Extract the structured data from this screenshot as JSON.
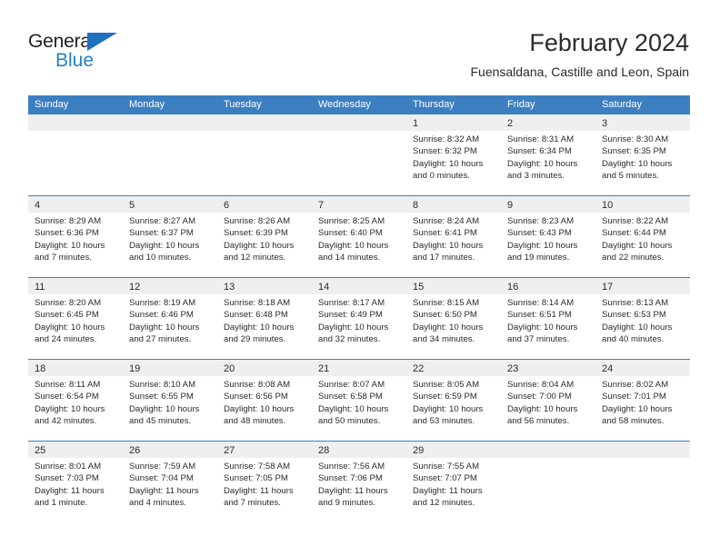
{
  "brand": {
    "name_top": "General",
    "name_bottom": "Blue",
    "triangle_color": "#1f72bd",
    "text_color": "#231f20",
    "blue_color": "#2581c4"
  },
  "header": {
    "title": "February 2024",
    "subtitle": "Fuensaldana, Castille and Leon, Spain"
  },
  "calendar": {
    "header_bg": "#3c7fc1",
    "header_text_color": "#ffffff",
    "band_bg": "#efefef",
    "weekdays": [
      "Sunday",
      "Monday",
      "Tuesday",
      "Wednesday",
      "Thursday",
      "Friday",
      "Saturday"
    ],
    "weeks": [
      [
        {
          "day": "",
          "lines": []
        },
        {
          "day": "",
          "lines": []
        },
        {
          "day": "",
          "lines": []
        },
        {
          "day": "",
          "lines": []
        },
        {
          "day": "1",
          "lines": [
            "Sunrise: 8:32 AM",
            "Sunset: 6:32 PM",
            "Daylight: 10 hours",
            "and 0 minutes."
          ]
        },
        {
          "day": "2",
          "lines": [
            "Sunrise: 8:31 AM",
            "Sunset: 6:34 PM",
            "Daylight: 10 hours",
            "and 3 minutes."
          ]
        },
        {
          "day": "3",
          "lines": [
            "Sunrise: 8:30 AM",
            "Sunset: 6:35 PM",
            "Daylight: 10 hours",
            "and 5 minutes."
          ]
        }
      ],
      [
        {
          "day": "4",
          "lines": [
            "Sunrise: 8:29 AM",
            "Sunset: 6:36 PM",
            "Daylight: 10 hours",
            "and 7 minutes."
          ]
        },
        {
          "day": "5",
          "lines": [
            "Sunrise: 8:27 AM",
            "Sunset: 6:37 PM",
            "Daylight: 10 hours",
            "and 10 minutes."
          ]
        },
        {
          "day": "6",
          "lines": [
            "Sunrise: 8:26 AM",
            "Sunset: 6:39 PM",
            "Daylight: 10 hours",
            "and 12 minutes."
          ]
        },
        {
          "day": "7",
          "lines": [
            "Sunrise: 8:25 AM",
            "Sunset: 6:40 PM",
            "Daylight: 10 hours",
            "and 14 minutes."
          ]
        },
        {
          "day": "8",
          "lines": [
            "Sunrise: 8:24 AM",
            "Sunset: 6:41 PM",
            "Daylight: 10 hours",
            "and 17 minutes."
          ]
        },
        {
          "day": "9",
          "lines": [
            "Sunrise: 8:23 AM",
            "Sunset: 6:43 PM",
            "Daylight: 10 hours",
            "and 19 minutes."
          ]
        },
        {
          "day": "10",
          "lines": [
            "Sunrise: 8:22 AM",
            "Sunset: 6:44 PM",
            "Daylight: 10 hours",
            "and 22 minutes."
          ]
        }
      ],
      [
        {
          "day": "11",
          "lines": [
            "Sunrise: 8:20 AM",
            "Sunset: 6:45 PM",
            "Daylight: 10 hours",
            "and 24 minutes."
          ]
        },
        {
          "day": "12",
          "lines": [
            "Sunrise: 8:19 AM",
            "Sunset: 6:46 PM",
            "Daylight: 10 hours",
            "and 27 minutes."
          ]
        },
        {
          "day": "13",
          "lines": [
            "Sunrise: 8:18 AM",
            "Sunset: 6:48 PM",
            "Daylight: 10 hours",
            "and 29 minutes."
          ]
        },
        {
          "day": "14",
          "lines": [
            "Sunrise: 8:17 AM",
            "Sunset: 6:49 PM",
            "Daylight: 10 hours",
            "and 32 minutes."
          ]
        },
        {
          "day": "15",
          "lines": [
            "Sunrise: 8:15 AM",
            "Sunset: 6:50 PM",
            "Daylight: 10 hours",
            "and 34 minutes."
          ]
        },
        {
          "day": "16",
          "lines": [
            "Sunrise: 8:14 AM",
            "Sunset: 6:51 PM",
            "Daylight: 10 hours",
            "and 37 minutes."
          ]
        },
        {
          "day": "17",
          "lines": [
            "Sunrise: 8:13 AM",
            "Sunset: 6:53 PM",
            "Daylight: 10 hours",
            "and 40 minutes."
          ]
        }
      ],
      [
        {
          "day": "18",
          "lines": [
            "Sunrise: 8:11 AM",
            "Sunset: 6:54 PM",
            "Daylight: 10 hours",
            "and 42 minutes."
          ]
        },
        {
          "day": "19",
          "lines": [
            "Sunrise: 8:10 AM",
            "Sunset: 6:55 PM",
            "Daylight: 10 hours",
            "and 45 minutes."
          ]
        },
        {
          "day": "20",
          "lines": [
            "Sunrise: 8:08 AM",
            "Sunset: 6:56 PM",
            "Daylight: 10 hours",
            "and 48 minutes."
          ]
        },
        {
          "day": "21",
          "lines": [
            "Sunrise: 8:07 AM",
            "Sunset: 6:58 PM",
            "Daylight: 10 hours",
            "and 50 minutes."
          ]
        },
        {
          "day": "22",
          "lines": [
            "Sunrise: 8:05 AM",
            "Sunset: 6:59 PM",
            "Daylight: 10 hours",
            "and 53 minutes."
          ]
        },
        {
          "day": "23",
          "lines": [
            "Sunrise: 8:04 AM",
            "Sunset: 7:00 PM",
            "Daylight: 10 hours",
            "and 56 minutes."
          ]
        },
        {
          "day": "24",
          "lines": [
            "Sunrise: 8:02 AM",
            "Sunset: 7:01 PM",
            "Daylight: 10 hours",
            "and 58 minutes."
          ]
        }
      ],
      [
        {
          "day": "25",
          "lines": [
            "Sunrise: 8:01 AM",
            "Sunset: 7:03 PM",
            "Daylight: 11 hours",
            "and 1 minute."
          ]
        },
        {
          "day": "26",
          "lines": [
            "Sunrise: 7:59 AM",
            "Sunset: 7:04 PM",
            "Daylight: 11 hours",
            "and 4 minutes."
          ]
        },
        {
          "day": "27",
          "lines": [
            "Sunrise: 7:58 AM",
            "Sunset: 7:05 PM",
            "Daylight: 11 hours",
            "and 7 minutes."
          ]
        },
        {
          "day": "28",
          "lines": [
            "Sunrise: 7:56 AM",
            "Sunset: 7:06 PM",
            "Daylight: 11 hours",
            "and 9 minutes."
          ]
        },
        {
          "day": "29",
          "lines": [
            "Sunrise: 7:55 AM",
            "Sunset: 7:07 PM",
            "Daylight: 11 hours",
            "and 12 minutes."
          ]
        },
        {
          "day": "",
          "lines": []
        },
        {
          "day": "",
          "lines": []
        }
      ]
    ]
  }
}
